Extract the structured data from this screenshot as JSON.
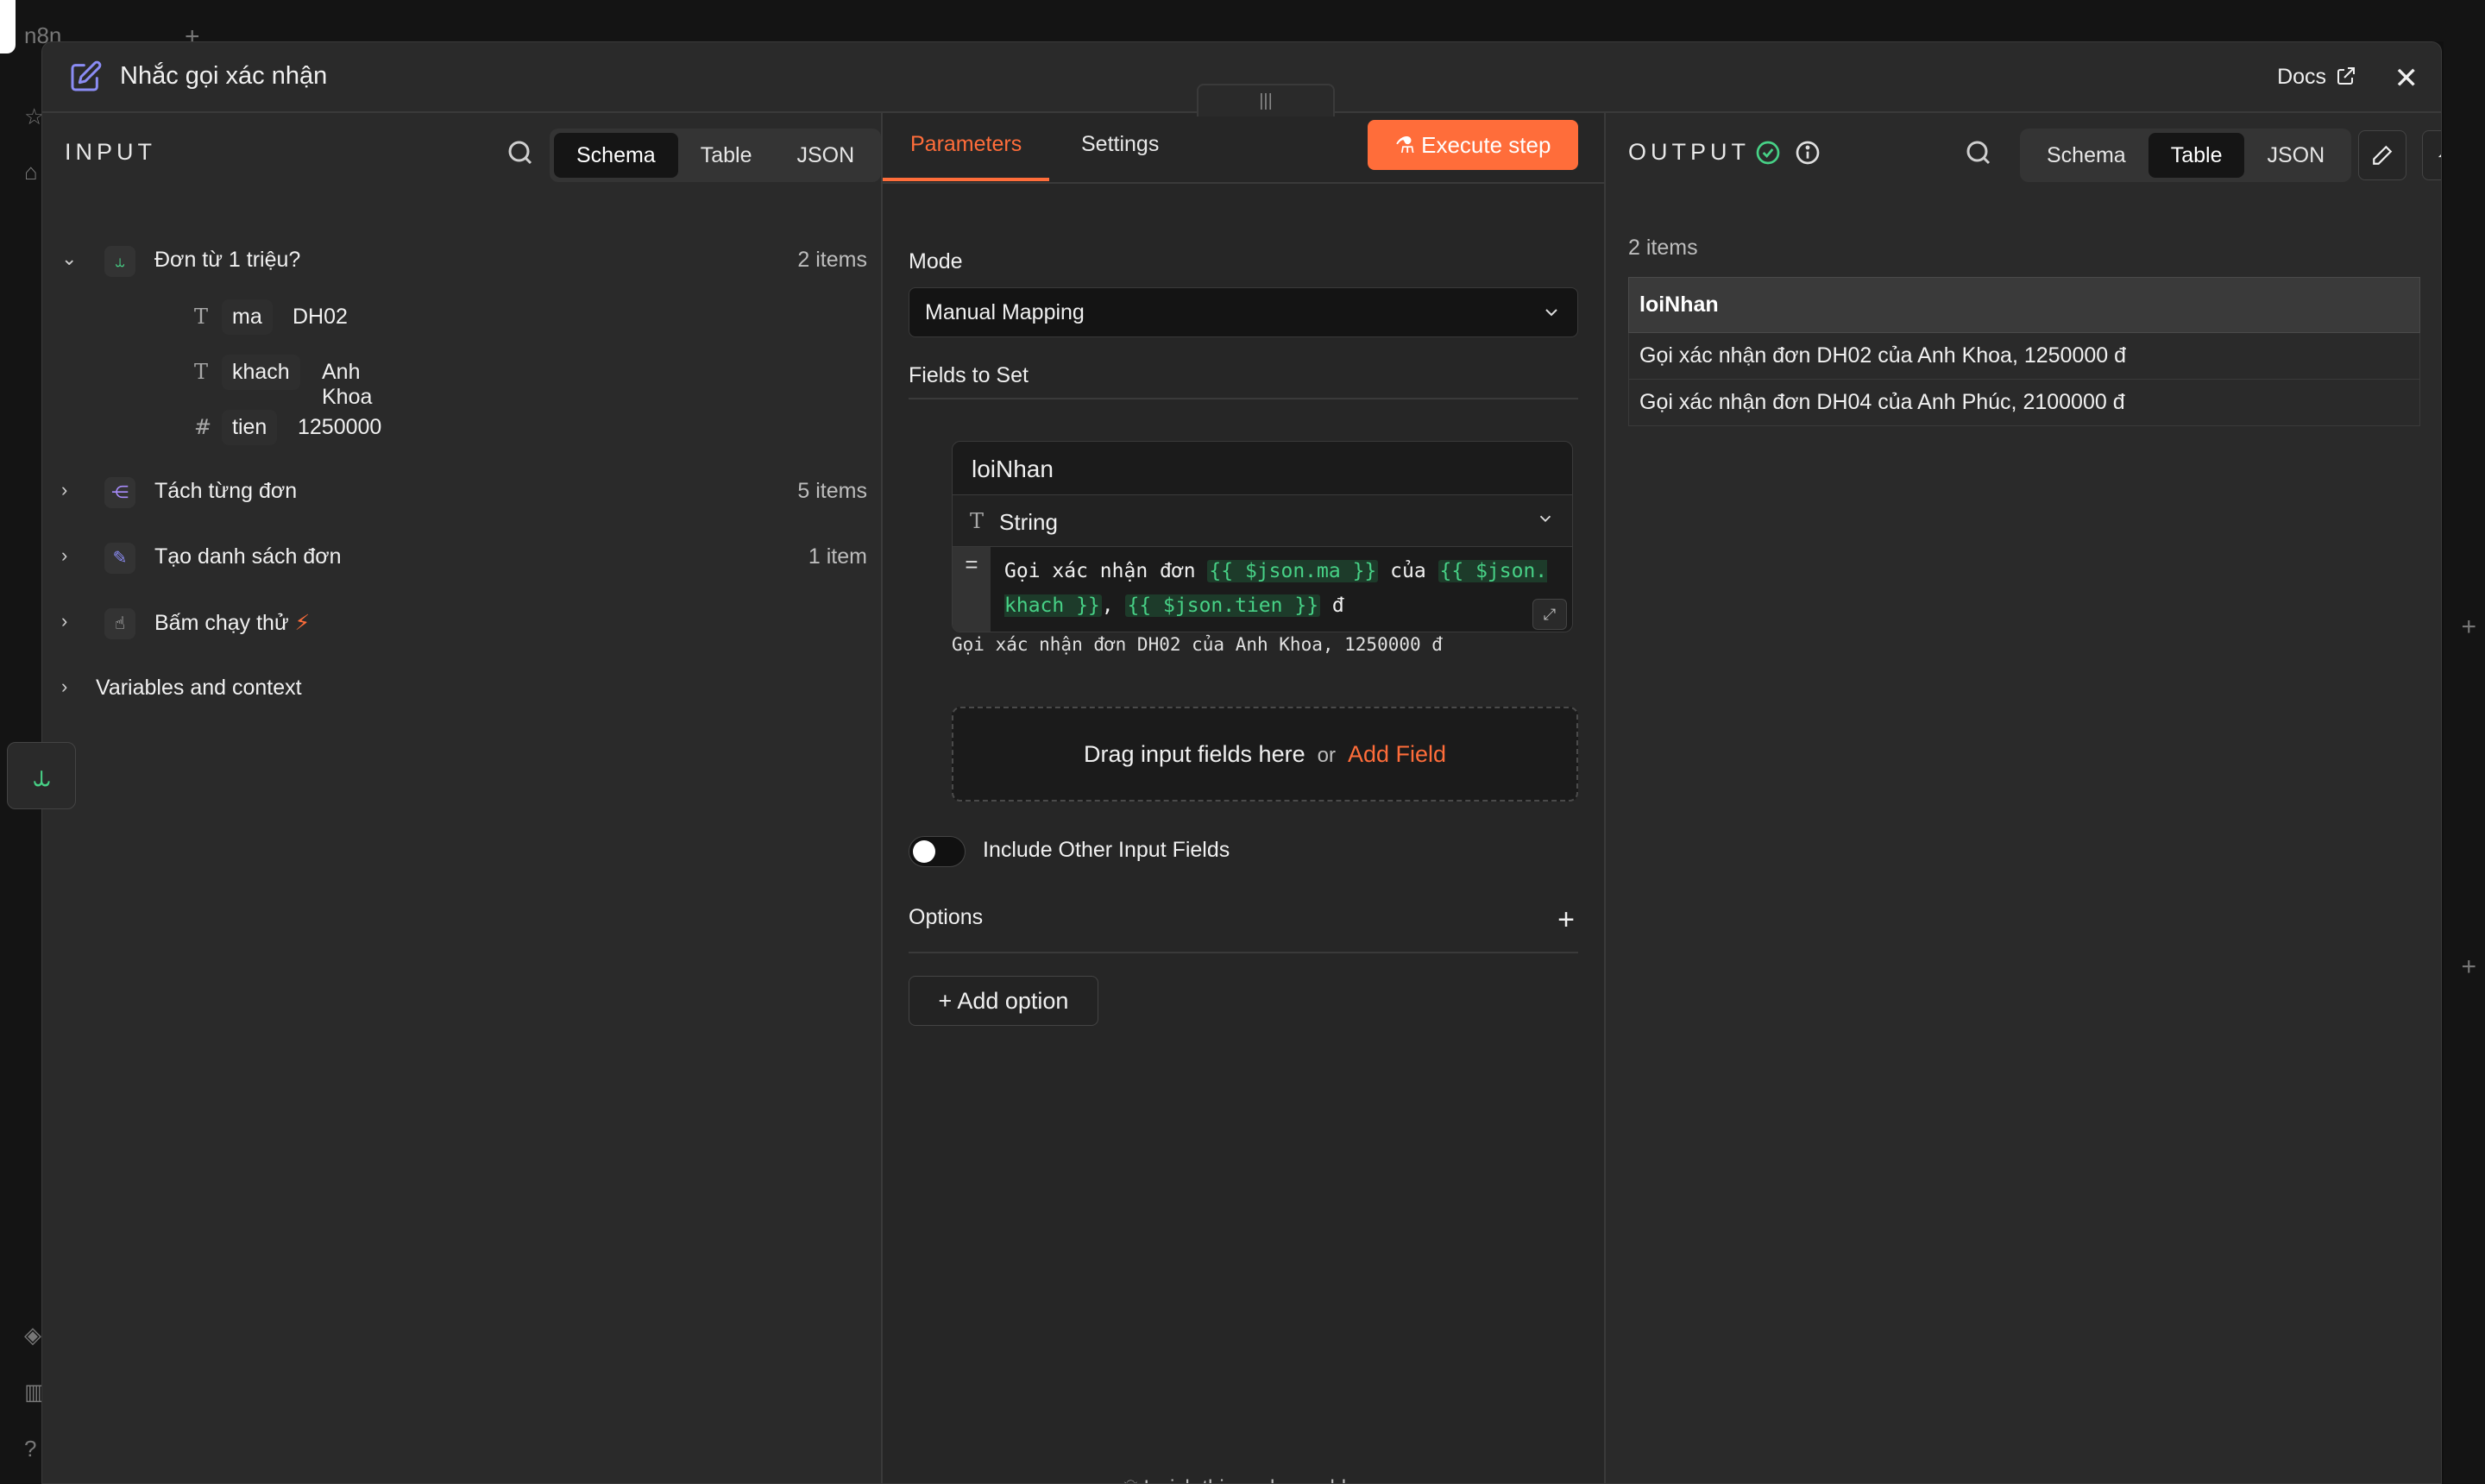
{
  "app": {
    "logo_text": "n8n"
  },
  "modal": {
    "title": "Nhắc gọi xác nhận",
    "docs_label": "Docs",
    "close_label": "✕",
    "drag_handle": "|||"
  },
  "input": {
    "label": "INPUT",
    "view_options": [
      "Schema",
      "Table",
      "JSON"
    ],
    "active_view": "Schema",
    "nodes": [
      {
        "name": "Đơn từ 1 triệu?",
        "count": "2 items",
        "expanded": true,
        "icon": "if-branch-icon",
        "icon_color": "#47d186",
        "fields": [
          {
            "type_icon": "T",
            "key": "ma",
            "value": "DH02"
          },
          {
            "type_icon": "T",
            "key": "khach",
            "value": "Anh Khoa"
          },
          {
            "type_icon": "#",
            "key": "tien",
            "value": "1250000"
          }
        ]
      },
      {
        "name": "Tách từng đơn",
        "count": "5 items",
        "expanded": false,
        "icon": "split-out-icon",
        "icon_color": "#a78bfa"
      },
      {
        "name": "Tạo danh sách đơn",
        "count": "1 item",
        "expanded": false,
        "icon": "edit-icon",
        "icon_color": "#8b8cf5"
      },
      {
        "name": "Bấm chạy thử",
        "count": "",
        "expanded": false,
        "icon": "pointer-icon",
        "icon_color": "#cfcfcf",
        "badge": "⚡"
      }
    ],
    "variables_label": "Variables and context"
  },
  "params": {
    "tabs": [
      "Parameters",
      "Settings"
    ],
    "active_tab": "Parameters",
    "execute_label": "Execute step",
    "mode_label": "Mode",
    "mode_value": "Manual Mapping",
    "fields_label": "Fields to Set",
    "assignment": {
      "name": "loiNhan",
      "type": "String",
      "expr_prefix": "Gọi xác nhận đơn ",
      "tok1": "{{ $json.ma }}",
      "expr_mid": " của ",
      "tok2": "{{ $json.khach }}",
      "expr_sep": ", ",
      "tok3": "{{ $json.tien }}",
      "expr_suffix": " đ",
      "preview": "Gọi xác nhận đơn DH02 của Anh Khoa, 1250000 đ"
    },
    "drop_text": "Drag input fields here",
    "drop_or": "or",
    "add_field": "Add Field",
    "include_other_label": "Include Other Input Fields",
    "include_other": false,
    "options_label": "Options",
    "add_option_label": "Add option",
    "wish_label": "I wish this node would..."
  },
  "output": {
    "label": "OUTPUT",
    "status": "success",
    "view_options": [
      "Schema",
      "Table",
      "JSON"
    ],
    "active_view": "Table",
    "count": "2 items",
    "columns": [
      "loiNhan"
    ],
    "rows": [
      [
        "Gọi xác nhận đơn DH02 của Anh Khoa, 1250000 đ"
      ],
      [
        "Gọi xác nhận đơn DH04 của Anh Phúc, 2100000 đ"
      ]
    ]
  },
  "colors": {
    "accent": "#ff6d3a",
    "success": "#47d186",
    "panel": "#2a2a2a"
  }
}
